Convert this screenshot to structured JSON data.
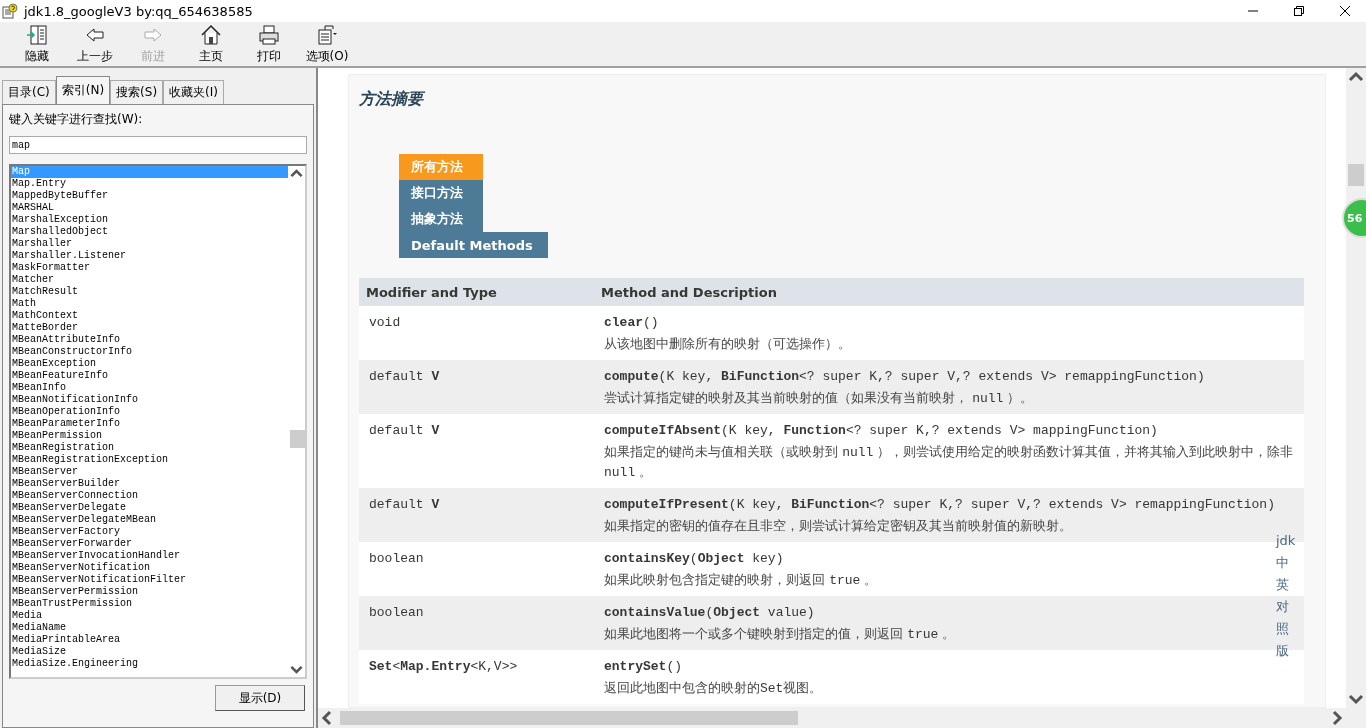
{
  "window": {
    "title": "jdk1.8_googleV3 by:qq_654638585"
  },
  "toolbar": [
    {
      "kind": "hide",
      "label": "隐藏",
      "disabled": false
    },
    {
      "kind": "back",
      "label": "上一步",
      "disabled": false
    },
    {
      "kind": "forward",
      "label": "前进",
      "disabled": true
    },
    {
      "kind": "home",
      "label": "主页",
      "disabled": false
    },
    {
      "kind": "print",
      "label": "打印",
      "disabled": false
    },
    {
      "kind": "options",
      "label": "选项(O)",
      "disabled": false
    }
  ],
  "nav_tabs": [
    {
      "label": "目录(C)",
      "selected": false
    },
    {
      "label": "索引(N)",
      "selected": true
    },
    {
      "label": "搜索(S)",
      "selected": false
    },
    {
      "label": "收藏夹(I)",
      "selected": false
    }
  ],
  "index": {
    "prompt": "键入关键字进行查找(W):",
    "search_value": "map",
    "items": [
      {
        "label": "Map",
        "selected": true
      },
      {
        "label": "Map.Entry",
        "selected": false
      },
      {
        "label": "MappedByteBuffer",
        "selected": false
      },
      {
        "label": "MARSHAL",
        "selected": false
      },
      {
        "label": "MarshalException",
        "selected": false
      },
      {
        "label": "MarshalledObject",
        "selected": false
      },
      {
        "label": "Marshaller",
        "selected": false
      },
      {
        "label": "Marshaller.Listener",
        "selected": false
      },
      {
        "label": "MaskFormatter",
        "selected": false
      },
      {
        "label": "Matcher",
        "selected": false
      },
      {
        "label": "MatchResult",
        "selected": false
      },
      {
        "label": "Math",
        "selected": false
      },
      {
        "label": "MathContext",
        "selected": false
      },
      {
        "label": "MatteBorder",
        "selected": false
      },
      {
        "label": "MBeanAttributeInfo",
        "selected": false
      },
      {
        "label": "MBeanConstructorInfo",
        "selected": false
      },
      {
        "label": "MBeanException",
        "selected": false
      },
      {
        "label": "MBeanFeatureInfo",
        "selected": false
      },
      {
        "label": "MBeanInfo",
        "selected": false
      },
      {
        "label": "MBeanNotificationInfo",
        "selected": false
      },
      {
        "label": "MBeanOperationInfo",
        "selected": false
      },
      {
        "label": "MBeanParameterInfo",
        "selected": false
      },
      {
        "label": "MBeanPermission",
        "selected": false
      },
      {
        "label": "MBeanRegistration",
        "selected": false
      },
      {
        "label": "MBeanRegistrationException",
        "selected": false
      },
      {
        "label": "MBeanServer",
        "selected": false
      },
      {
        "label": "MBeanServerBuilder",
        "selected": false
      },
      {
        "label": "MBeanServerConnection",
        "selected": false
      },
      {
        "label": "MBeanServerDelegate",
        "selected": false
      },
      {
        "label": "MBeanServerDelegateMBean",
        "selected": false
      },
      {
        "label": "MBeanServerFactory",
        "selected": false
      },
      {
        "label": "MBeanServerForwarder",
        "selected": false
      },
      {
        "label": "MBeanServerInvocationHandler",
        "selected": false
      },
      {
        "label": "MBeanServerNotification",
        "selected": false
      },
      {
        "label": "MBeanServerNotificationFilter",
        "selected": false
      },
      {
        "label": "MBeanServerPermission",
        "selected": false
      },
      {
        "label": "MBeanTrustPermission",
        "selected": false
      },
      {
        "label": "Media",
        "selected": false
      },
      {
        "label": "MediaName",
        "selected": false
      },
      {
        "label": "MediaPrintableArea",
        "selected": false
      },
      {
        "label": "MediaSize",
        "selected": false
      },
      {
        "label": "MediaSize.Engineering",
        "selected": false
      }
    ],
    "display_button": "显示(D)"
  },
  "content": {
    "heading": "方法摘要",
    "method_tabs": [
      {
        "label": "所有方法",
        "selected": true
      },
      {
        "label": "接口方法",
        "selected": false
      },
      {
        "label": "抽象方法",
        "selected": false
      },
      {
        "label": "Default Methods",
        "selected": false
      }
    ],
    "columns": [
      "Modifier and Type",
      "Method and Description"
    ],
    "rows": [
      {
        "type": "void",
        "signature": "**clear**()",
        "description": [
          {
            "text": "从该地图中删除所有的映射（可选操作）。",
            "code": false
          }
        ]
      },
      {
        "type": "default **V**",
        "signature": "**compute**(K key, **BiFunction**<? super K,? super V,? extends V> remappingFunction)",
        "description": [
          {
            "text": "尝试计算指定键的映射及其当前映射的值（如果没有当前映射， ",
            "code": false
          },
          {
            "text": "null",
            "code": true
          },
          {
            "text": " ）。",
            "code": false
          }
        ]
      },
      {
        "type": "default **V**",
        "signature": "**computeIfAbsent**(K key, **Function**<? super K,? extends V> mappingFunction)",
        "description": [
          {
            "text": "如果指定的键尚未与值相关联（或映射到 ",
            "code": false
          },
          {
            "text": "null",
            "code": true
          },
          {
            "text": " ），则尝试使用给定的映射函数计算其值，并将其输入到此映射中，除非 ",
            "code": false
          },
          {
            "text": "null",
            "code": true
          },
          {
            "text": " 。",
            "code": false
          }
        ]
      },
      {
        "type": "default **V**",
        "signature": "**computeIfPresent**(K key, **BiFunction**<? super K,? super V,? extends V> remappingFunction)",
        "description": [
          {
            "text": "如果指定的密钥的值存在且非空，则尝试计算给定密钥及其当前映射值的新映射。",
            "code": false
          }
        ]
      },
      {
        "type": "boolean",
        "signature": "**containsKey**(**Object** key)",
        "description": [
          {
            "text": "如果此映射包含指定键的映射，则返回 ",
            "code": false
          },
          {
            "text": "true",
            "code": true
          },
          {
            "text": " 。",
            "code": false
          }
        ]
      },
      {
        "type": "boolean",
        "signature": "**containsValue**(**Object** value)",
        "description": [
          {
            "text": "如果此地图将一个或多个键映射到指定的值，则返回 ",
            "code": false
          },
          {
            "text": "true",
            "code": true
          },
          {
            "text": " 。",
            "code": false
          }
        ]
      },
      {
        "type": "**Set**<**Map.Entry**<K,V>>",
        "signature": "**entrySet**()",
        "description": [
          {
            "text": "返回此地图中包含的映射的",
            "code": false
          },
          {
            "text": "Set",
            "code": true
          },
          {
            "text": "视图。",
            "code": false
          }
        ]
      }
    ],
    "side_link": "jdk中英对照版",
    "badge": "56"
  }
}
